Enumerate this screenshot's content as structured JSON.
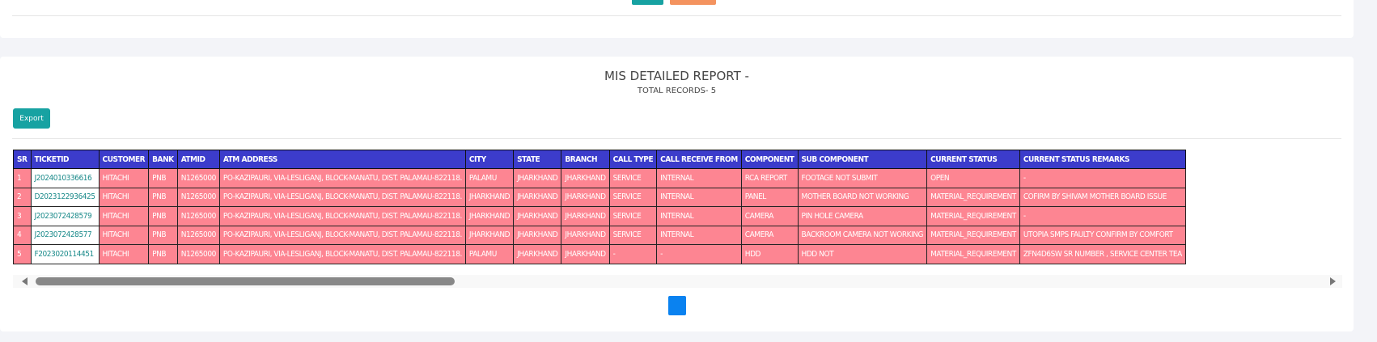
{
  "report": {
    "title": "MIS DETAILED REPORT -",
    "subtitle": "TOTAL RECORDS- 5",
    "export_label": "Export"
  },
  "table": {
    "columns": [
      "SR",
      "TICKETID",
      "CUSTOMER",
      "BANK",
      "ATMID",
      "ATM ADDRESS",
      "CITY",
      "STATE",
      "BRANCH",
      "CALL TYPE",
      "CALL RECEIVE FROM",
      "COMPONENT",
      "SUB COMPONENT",
      "CURRENT STATUS",
      "CURRENT STATUS REMARKS"
    ],
    "rows": [
      [
        "1",
        "J2024010336616",
        "HITACHI",
        "PNB",
        "N1265000",
        "PO-KAZIPAURI, VIA-LESLIGANJ, BLOCK-MANATU, DIST. PALAMAU-822118.",
        "PALAMU",
        "JHARKHAND",
        "JHARKHAND",
        "SERVICE",
        "INTERNAL",
        "RCA REPORT",
        "FOOTAGE NOT SUBMIT",
        "OPEN",
        "-"
      ],
      [
        "2",
        "D2023122936425",
        "HITACHI",
        "PNB",
        "N1265000",
        "PO-KAZIPAURI, VIA-LESLIGANJ, BLOCK-MANATU, DIST. PALAMAU-822118.",
        "JHARKHAND",
        "JHARKHAND",
        "JHARKHAND",
        "SERVICE",
        "INTERNAL",
        "PANEL",
        "MOTHER BOARD NOT WORKING",
        "MATERIAL_REQUIREMENT",
        "COFIRM BY SHIVAM MOTHER BOARD ISSUE"
      ],
      [
        "3",
        "J2023072428579",
        "HITACHI",
        "PNB",
        "N1265000",
        "PO-KAZIPAURI, VIA-LESLIGANJ, BLOCK-MANATU, DIST. PALAMAU-822118.",
        "JHARKHAND",
        "JHARKHAND",
        "JHARKHAND",
        "SERVICE",
        "INTERNAL",
        "CAMERA",
        "PIN HOLE CAMERA",
        "MATERIAL_REQUIREMENT",
        "-"
      ],
      [
        "4",
        "J2023072428577",
        "HITACHI",
        "PNB",
        "N1265000",
        "PO-KAZIPAURI, VIA-LESLIGANJ, BLOCK-MANATU, DIST. PALAMAU-822118.",
        "JHARKHAND",
        "JHARKHAND",
        "JHARKHAND",
        "SERVICE",
        "INTERNAL",
        "CAMERA",
        "BACKROOM CAMERA NOT WORKING",
        "MATERIAL_REQUIREMENT",
        "UTOPIA SMPS FAULTY CONFIRM BY COMFORT"
      ],
      [
        "5",
        "F2023020114451",
        "HITACHI",
        "PNB",
        "N1265000",
        "PO-KAZIPAURI, VIA-LESLIGANJ, BLOCK-MANATU, DIST. PALAMAU-822118.",
        "PALAMU",
        "JHARKHAND",
        "JHARKHAND",
        "-",
        "-",
        "HDD",
        "HDD NOT",
        "MATERIAL_REQUIREMENT",
        "ZFN4D6SW SR NUMBER , SERVICE CENTER TEA"
      ]
    ]
  },
  "pagination": {
    "current_page": "1"
  },
  "colors": {
    "header_bg": "#3c3ccb",
    "row_bg": "#fd8592",
    "accent_teal": "#17a2a2",
    "accent_orange": "#f4935f",
    "pager_blue": "#0a82f0"
  },
  "icons": {
    "scroll_left": "triangle-left-icon",
    "scroll_right": "triangle-right-icon"
  }
}
